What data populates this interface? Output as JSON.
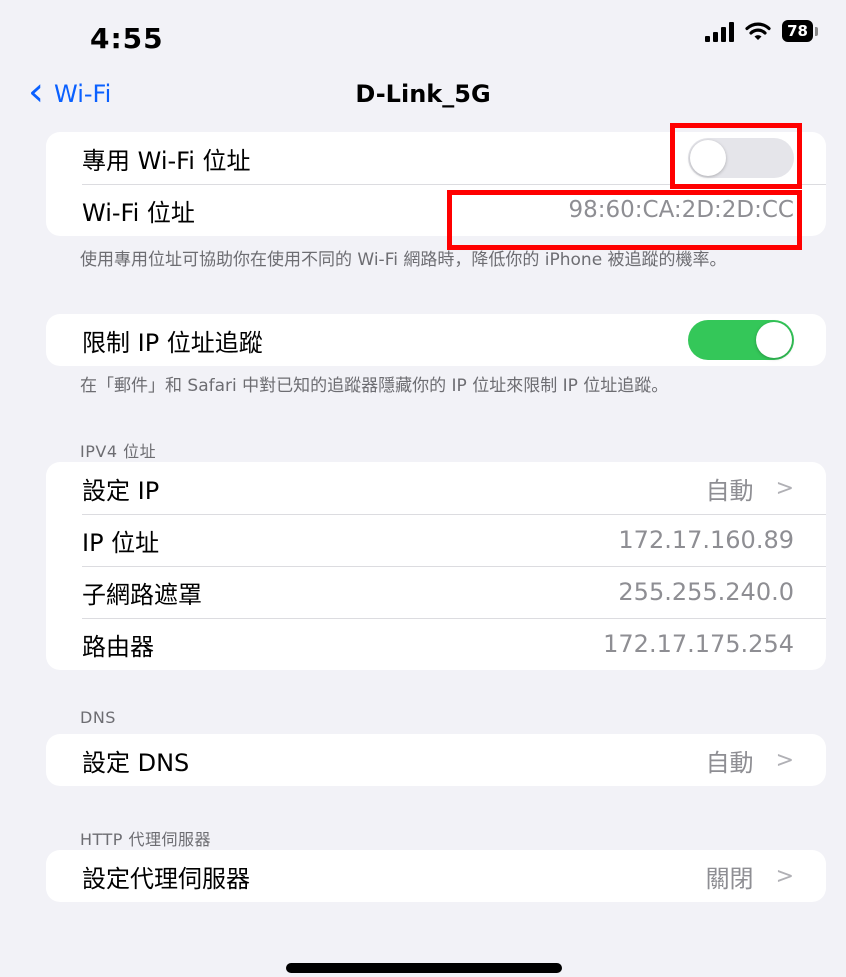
{
  "status_bar": {
    "time": "4:55",
    "battery": "78"
  },
  "nav": {
    "back_label": "Wi-Fi",
    "title": "D-Link_5G"
  },
  "private_address": {
    "toggle_label": "專用 Wi-Fi 位址",
    "toggle_on": false,
    "address_label": "Wi-Fi 位址",
    "address_value": "98:60:CA:2D:2D:CC",
    "footer": "使用專用位址可協助你在使用不同的 Wi-Fi 網路時，降低你的 iPhone 被追蹤的機率。"
  },
  "limit_tracking": {
    "label": "限制 IP 位址追蹤",
    "toggle_on": true,
    "footer": "在「郵件」和 Safari 中對已知的追蹤器隱藏你的 IP 位址來限制 IP 位址追蹤。"
  },
  "ipv4": {
    "header": "IPV4 位址",
    "rows": [
      {
        "label": "設定 IP",
        "value": "自動"
      },
      {
        "label": "IP 位址",
        "value": "172.17.160.89"
      },
      {
        "label": "子網路遮罩",
        "value": "255.255.240.0"
      },
      {
        "label": "路由器",
        "value": "172.17.175.254"
      }
    ]
  },
  "dns": {
    "header": "DNS",
    "rows": [
      {
        "label": "設定 DNS",
        "value": "自動"
      }
    ]
  },
  "proxy": {
    "header": "HTTP 代理伺服器",
    "rows": [
      {
        "label": "設定代理伺服器",
        "value": "關閉"
      }
    ]
  },
  "colors": {
    "accent": "#0a60ff",
    "toggle_on": "#34c759",
    "highlight": "#ff0000"
  }
}
